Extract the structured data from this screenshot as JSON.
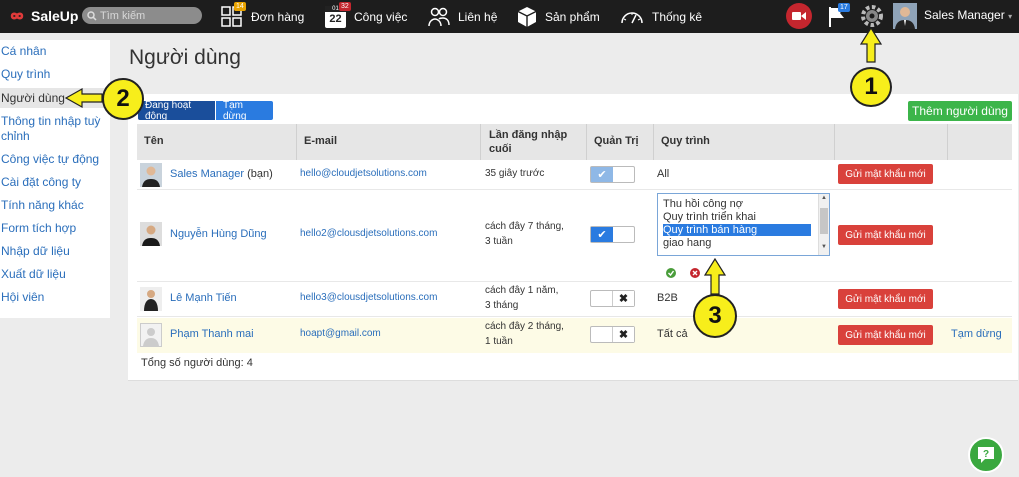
{
  "topbar": {
    "logo_text": "SaleUp",
    "search_placeholder": "Tìm kiếm",
    "nav": [
      {
        "label": "Đơn hàng",
        "icon": "grid-icon",
        "badge": "14"
      },
      {
        "label": "Công việc",
        "icon": "calendar-icon",
        "badge": "32",
        "calendar_top": "01",
        "calendar_day": "22"
      },
      {
        "label": "Liên hệ",
        "icon": "contacts-icon"
      },
      {
        "label": "Sản phẩm",
        "icon": "box-icon"
      },
      {
        "label": "Thống kê",
        "icon": "gauge-icon"
      }
    ],
    "flag_badge": "17",
    "user_name": "Sales Manager",
    "user_caret": "▾"
  },
  "sidebar": {
    "items": [
      {
        "label": "Cá nhân"
      },
      {
        "label": "Quy trình"
      },
      {
        "label": "Người dùng",
        "active": true
      },
      {
        "label": "Thông tin nhập tuỳ chỉnh"
      },
      {
        "label": "Công việc tự động"
      },
      {
        "label": "Cài đặt công ty"
      },
      {
        "label": "Tính năng khác"
      },
      {
        "label": "Form tích hợp"
      },
      {
        "label": "Nhập dữ liệu"
      },
      {
        "label": "Xuất dữ liệu"
      },
      {
        "label": "Hội viên"
      }
    ]
  },
  "page": {
    "title": "Người dùng",
    "filter_active": "Đang hoạt động",
    "filter_paused": "Tạm dừng",
    "add_user": "Thêm người dùng",
    "total": "Tổng số người dùng: 4"
  },
  "table": {
    "headers": {
      "name": "Tên",
      "email": "E-mail",
      "last_login": "Lần đăng nhập cuối",
      "admin": "Quản Trị",
      "process": "Quy trình"
    },
    "rows": [
      {
        "name": "Sales Manager",
        "you": "(bạn)",
        "email": "hello@cloudjetsolutions.com",
        "last_login_1": "35 giây trước",
        "last_login_2": "",
        "admin": "on-light",
        "process": "All",
        "send": "Gửi mật khẩu mới",
        "action": ""
      },
      {
        "name": "Nguyễn Hùng Dũng",
        "email": "hello2@clousdjetsolutions.com",
        "last_login_1": "cách đây 7 tháng,",
        "last_login_2": "3 tuần",
        "admin": "on",
        "process": "",
        "send": "Gửi mật khẩu mới",
        "action": ""
      },
      {
        "name": "Lê Mạnh Tiến",
        "email": "hello3@clousdjetsolutions.com",
        "last_login_1": "cách đây 1 năm,",
        "last_login_2": "3 tháng",
        "admin": "off",
        "process": "B2B",
        "send": "Gửi mật khẩu mới",
        "action": ""
      },
      {
        "name": "Phạm Thanh mai",
        "email": "hoapt@gmail.com",
        "last_login_1": "cách đây 2 tháng,",
        "last_login_2": "1 tuần",
        "admin": "off",
        "process": "Tất cả",
        "send": "Gửi mật khẩu mới",
        "action": "Tạm dừng"
      }
    ],
    "process_options": [
      {
        "label": "Thu hồi công nợ",
        "selected": false
      },
      {
        "label": "Quy trình triển khai",
        "selected": false
      },
      {
        "label": "Quy trình bán hàng",
        "selected": true
      },
      {
        "label": "giao hang",
        "selected": false
      }
    ],
    "confirm_icon": "check-circle-icon",
    "cancel_icon": "x-circle-icon"
  },
  "callouts": [
    "1",
    "2",
    "3"
  ],
  "colors": {
    "topbar": "#1d1d1d",
    "link": "#2a6ebb",
    "primary": "#2a7be0",
    "success": "#3cb54a",
    "danger": "#d9413b",
    "highlight_row": "#fdfbe6",
    "callout": "#f7ee1b"
  }
}
